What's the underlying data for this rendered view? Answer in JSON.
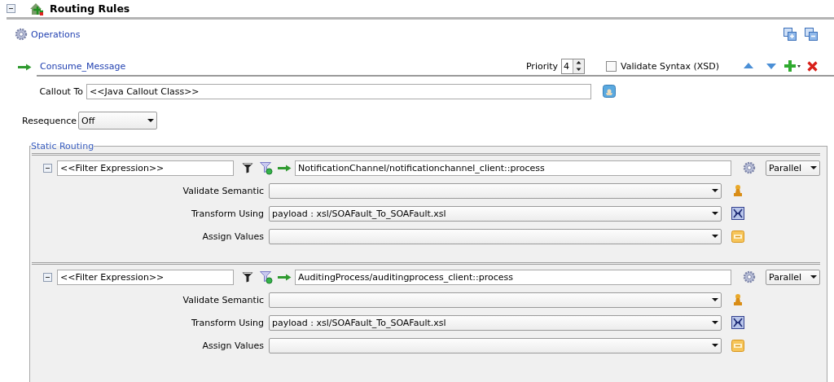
{
  "header": {
    "title": "Routing Rules",
    "expanded": true
  },
  "operations_link": "Operations",
  "route": {
    "name": "Consume_Message",
    "priority_label": "Priority",
    "priority": "4",
    "validate_syntax": {
      "label": "Validate Syntax (XSD)",
      "checked": false
    },
    "callout": {
      "label": "Callout To",
      "value": "<<Java Callout Class>>"
    },
    "resequence": {
      "label": "Resequence",
      "value": "Off"
    },
    "static_routing": {
      "title": "Static Routing",
      "targets": [
        {
          "expanded": true,
          "filter": "<<Filter Expression>>",
          "service": "NotificationChannel/notificationchannel_client::process",
          "mode": "Parallel",
          "fields": [
            {
              "kind": "semantic",
              "label": "Validate Semantic"
            },
            {
              "kind": "transform",
              "label": "Transform Using",
              "value": "payload : xsl/SOAFault_To_SOAFault.xsl"
            },
            {
              "kind": "assign",
              "label": "Assign Values"
            }
          ]
        },
        {
          "expanded": true,
          "filter": "<<Filter Expression>>",
          "service": "AuditingProcess/auditingprocess_client::process",
          "mode": "Parallel",
          "fields": [
            {
              "kind": "semantic",
              "label": "Validate Semantic"
            },
            {
              "kind": "transform",
              "label": "Transform Using",
              "value": "payload : xsl/SOAFault_To_SOAFault.xsl"
            },
            {
              "kind": "assign",
              "label": "Assign Values"
            }
          ]
        }
      ]
    }
  }
}
